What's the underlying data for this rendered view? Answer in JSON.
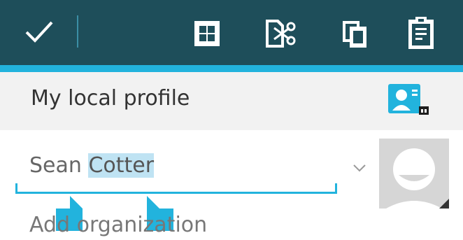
{
  "toolbar": {
    "background": "#1e4e5a",
    "accent": "#22b3dd",
    "icons": {
      "done": "checkmark-icon",
      "select_all": "select-all-icon",
      "cut": "cut-icon",
      "copy": "copy-icon",
      "paste": "paste-icon"
    }
  },
  "profile": {
    "label": "My local profile",
    "badge_icon": "contact-card-icon"
  },
  "name_field": {
    "prefix": "Sean ",
    "selected": "Cotter",
    "selection_color": "#bfe3f3"
  },
  "organization_field": {
    "placeholder": "Add organization"
  },
  "photo": {
    "icon": "default-avatar-icon"
  }
}
